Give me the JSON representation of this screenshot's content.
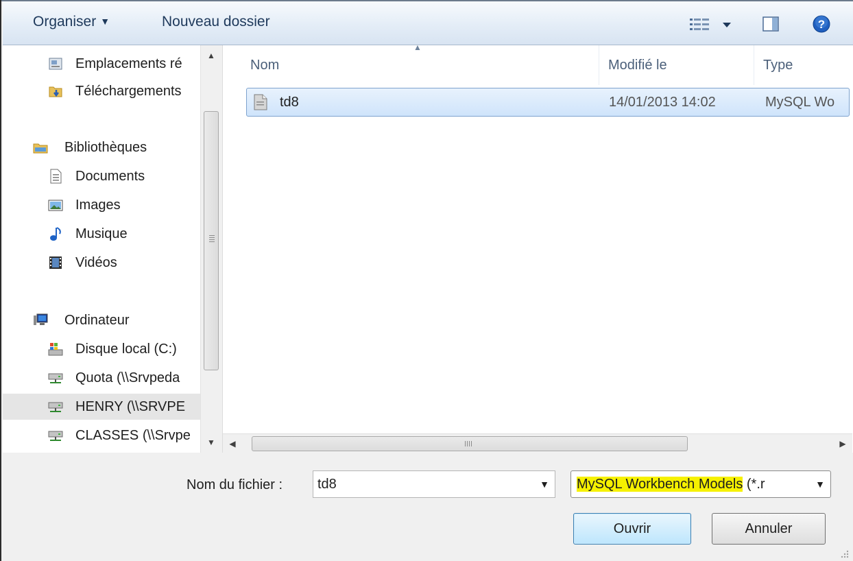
{
  "toolbar": {
    "organise_label": "Organiser",
    "new_folder_label": "Nouveau dossier"
  },
  "nav": {
    "items": [
      {
        "label": "Emplacements ré",
        "icon": "recent-places-icon"
      },
      {
        "label": "Téléchargements",
        "icon": "downloads-folder-icon"
      },
      {
        "label": "Bibliothèques",
        "icon": "libraries-icon"
      },
      {
        "label": "Documents",
        "icon": "documents-icon"
      },
      {
        "label": "Images",
        "icon": "images-icon"
      },
      {
        "label": "Musique",
        "icon": "music-icon"
      },
      {
        "label": "Vidéos",
        "icon": "videos-icon"
      },
      {
        "label": "Ordinateur",
        "icon": "computer-icon"
      },
      {
        "label": "Disque local (C:)",
        "icon": "local-disk-icon"
      },
      {
        "label": "Quota (\\\\Srvpeda",
        "icon": "network-drive-icon"
      },
      {
        "label": "HENRY (\\\\SRVPE",
        "icon": "network-drive-icon",
        "selected": true
      },
      {
        "label": "CLASSES (\\\\Srvpe",
        "icon": "network-drive-icon"
      }
    ]
  },
  "files": {
    "columns": {
      "name": "Nom",
      "modified": "Modifié le",
      "type": "Type"
    },
    "rows": [
      {
        "name": "td8",
        "modified": "14/01/2013 14:02",
        "type": "MySQL Wo"
      }
    ]
  },
  "bottom": {
    "filename_label": "Nom du fichier :",
    "filename_value": "td8",
    "filter_highlighted": "MySQL Workbench Models",
    "filter_rest": " (*.r",
    "open_label": "Ouvrir",
    "cancel_label": "Annuler"
  },
  "colors": {
    "selection_fill": "#cfe4fb",
    "selection_border": "#7da2ce",
    "highlight": "#f6f100",
    "toolbar_text": "#1e395b"
  }
}
